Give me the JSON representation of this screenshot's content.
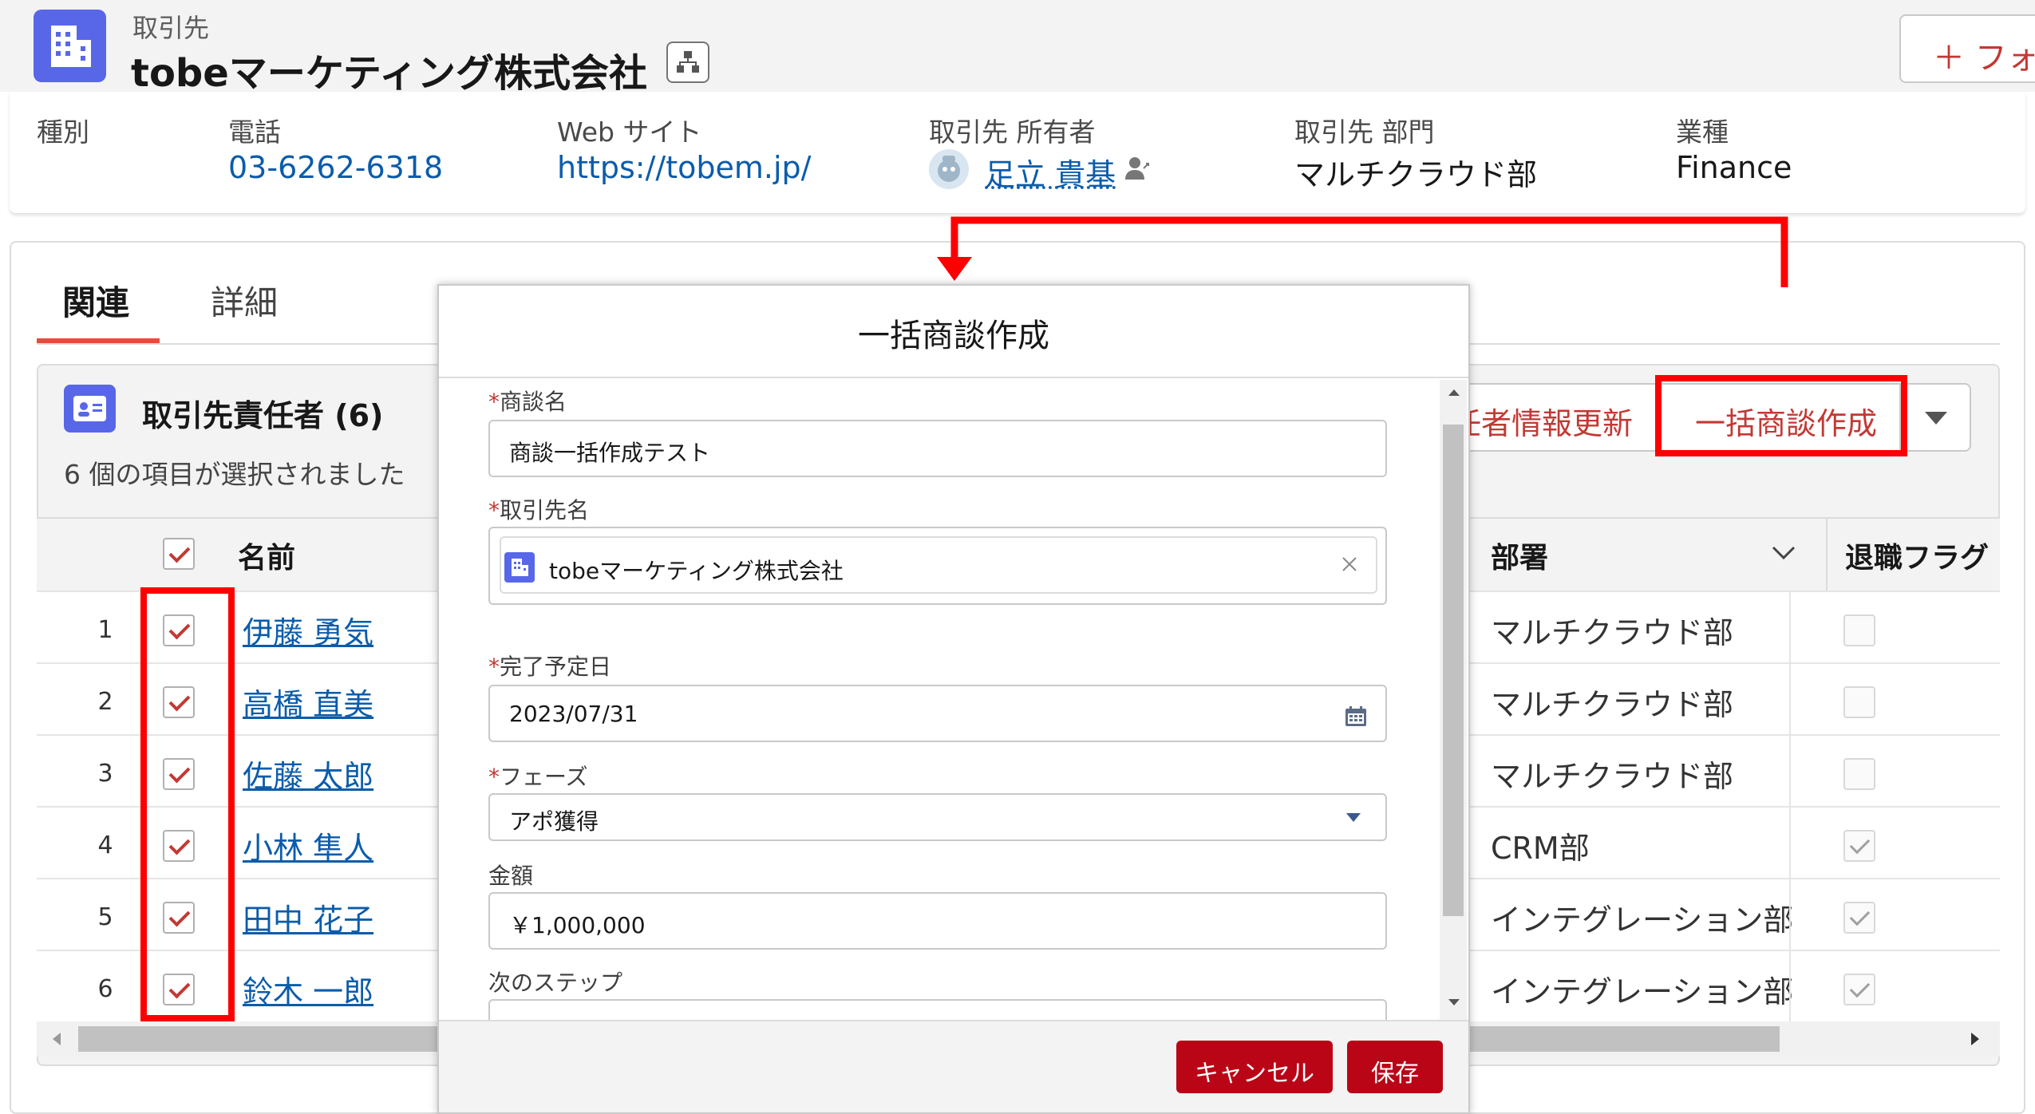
{
  "record": {
    "object_type": "取引先",
    "name": "tobeマーケティング株式会社",
    "follow_label": "＋ フォ"
  },
  "highlights": [
    {
      "label": "種別",
      "value": ""
    },
    {
      "label": "電話",
      "value": "03-6262-6318"
    },
    {
      "label": "Web サイト",
      "value": "https://tobem.jp/"
    },
    {
      "label": "取引先 所有者",
      "value": "足立 貴基"
    },
    {
      "label": "取引先 部門",
      "value": "マルチクラウド部"
    },
    {
      "label": "業種",
      "value": "Finance"
    }
  ],
  "tabs": [
    {
      "label": "関連",
      "active": true
    },
    {
      "label": "詳細",
      "active": false
    }
  ],
  "related": {
    "title": "取引先責任者 (6)",
    "selected_text": "6 個の項目が選択されました",
    "buttons": {
      "update": "任者情報更新",
      "bulk_create": "一括商談作成"
    },
    "columns": {
      "name": "名前",
      "dept": "部署",
      "retired": "退職フラグ"
    },
    "rows": [
      {
        "num": "1",
        "name": "伊藤 勇気",
        "dept": "マルチクラウド部",
        "retired": false
      },
      {
        "num": "2",
        "name": "高橋 直美",
        "dept": "マルチクラウド部",
        "retired": false
      },
      {
        "num": "3",
        "name": "佐藤 太郎",
        "dept": "マルチクラウド部",
        "retired": false
      },
      {
        "num": "4",
        "name": "小林 隼人",
        "dept": "CRM部",
        "retired": true
      },
      {
        "num": "5",
        "name": "田中 花子",
        "dept": "インテグレーション部",
        "retired": true
      },
      {
        "num": "6",
        "name": "鈴木 一郎",
        "dept": "インテグレーション部",
        "retired": true
      }
    ]
  },
  "modal": {
    "title": "一括商談作成",
    "fields": {
      "opp_name_label": "商談名",
      "opp_name_value": "商談一括作成テスト",
      "account_label": "取引先名",
      "account_value": "tobeマーケティング株式会社",
      "close_date_label": "完了予定日",
      "close_date_value": "2023/07/31",
      "phase_label": "フェーズ",
      "phase_value": "アポ獲得",
      "amount_label": "金額",
      "amount_value": "￥1,000,000",
      "next_step_label": "次のステップ"
    },
    "cancel_label": "キャンセル",
    "save_label": "保存"
  },
  "colors": {
    "accent": "#c23934",
    "brand": "#5867e8",
    "link": "#0b5cab",
    "highlight": "#ff0000"
  }
}
